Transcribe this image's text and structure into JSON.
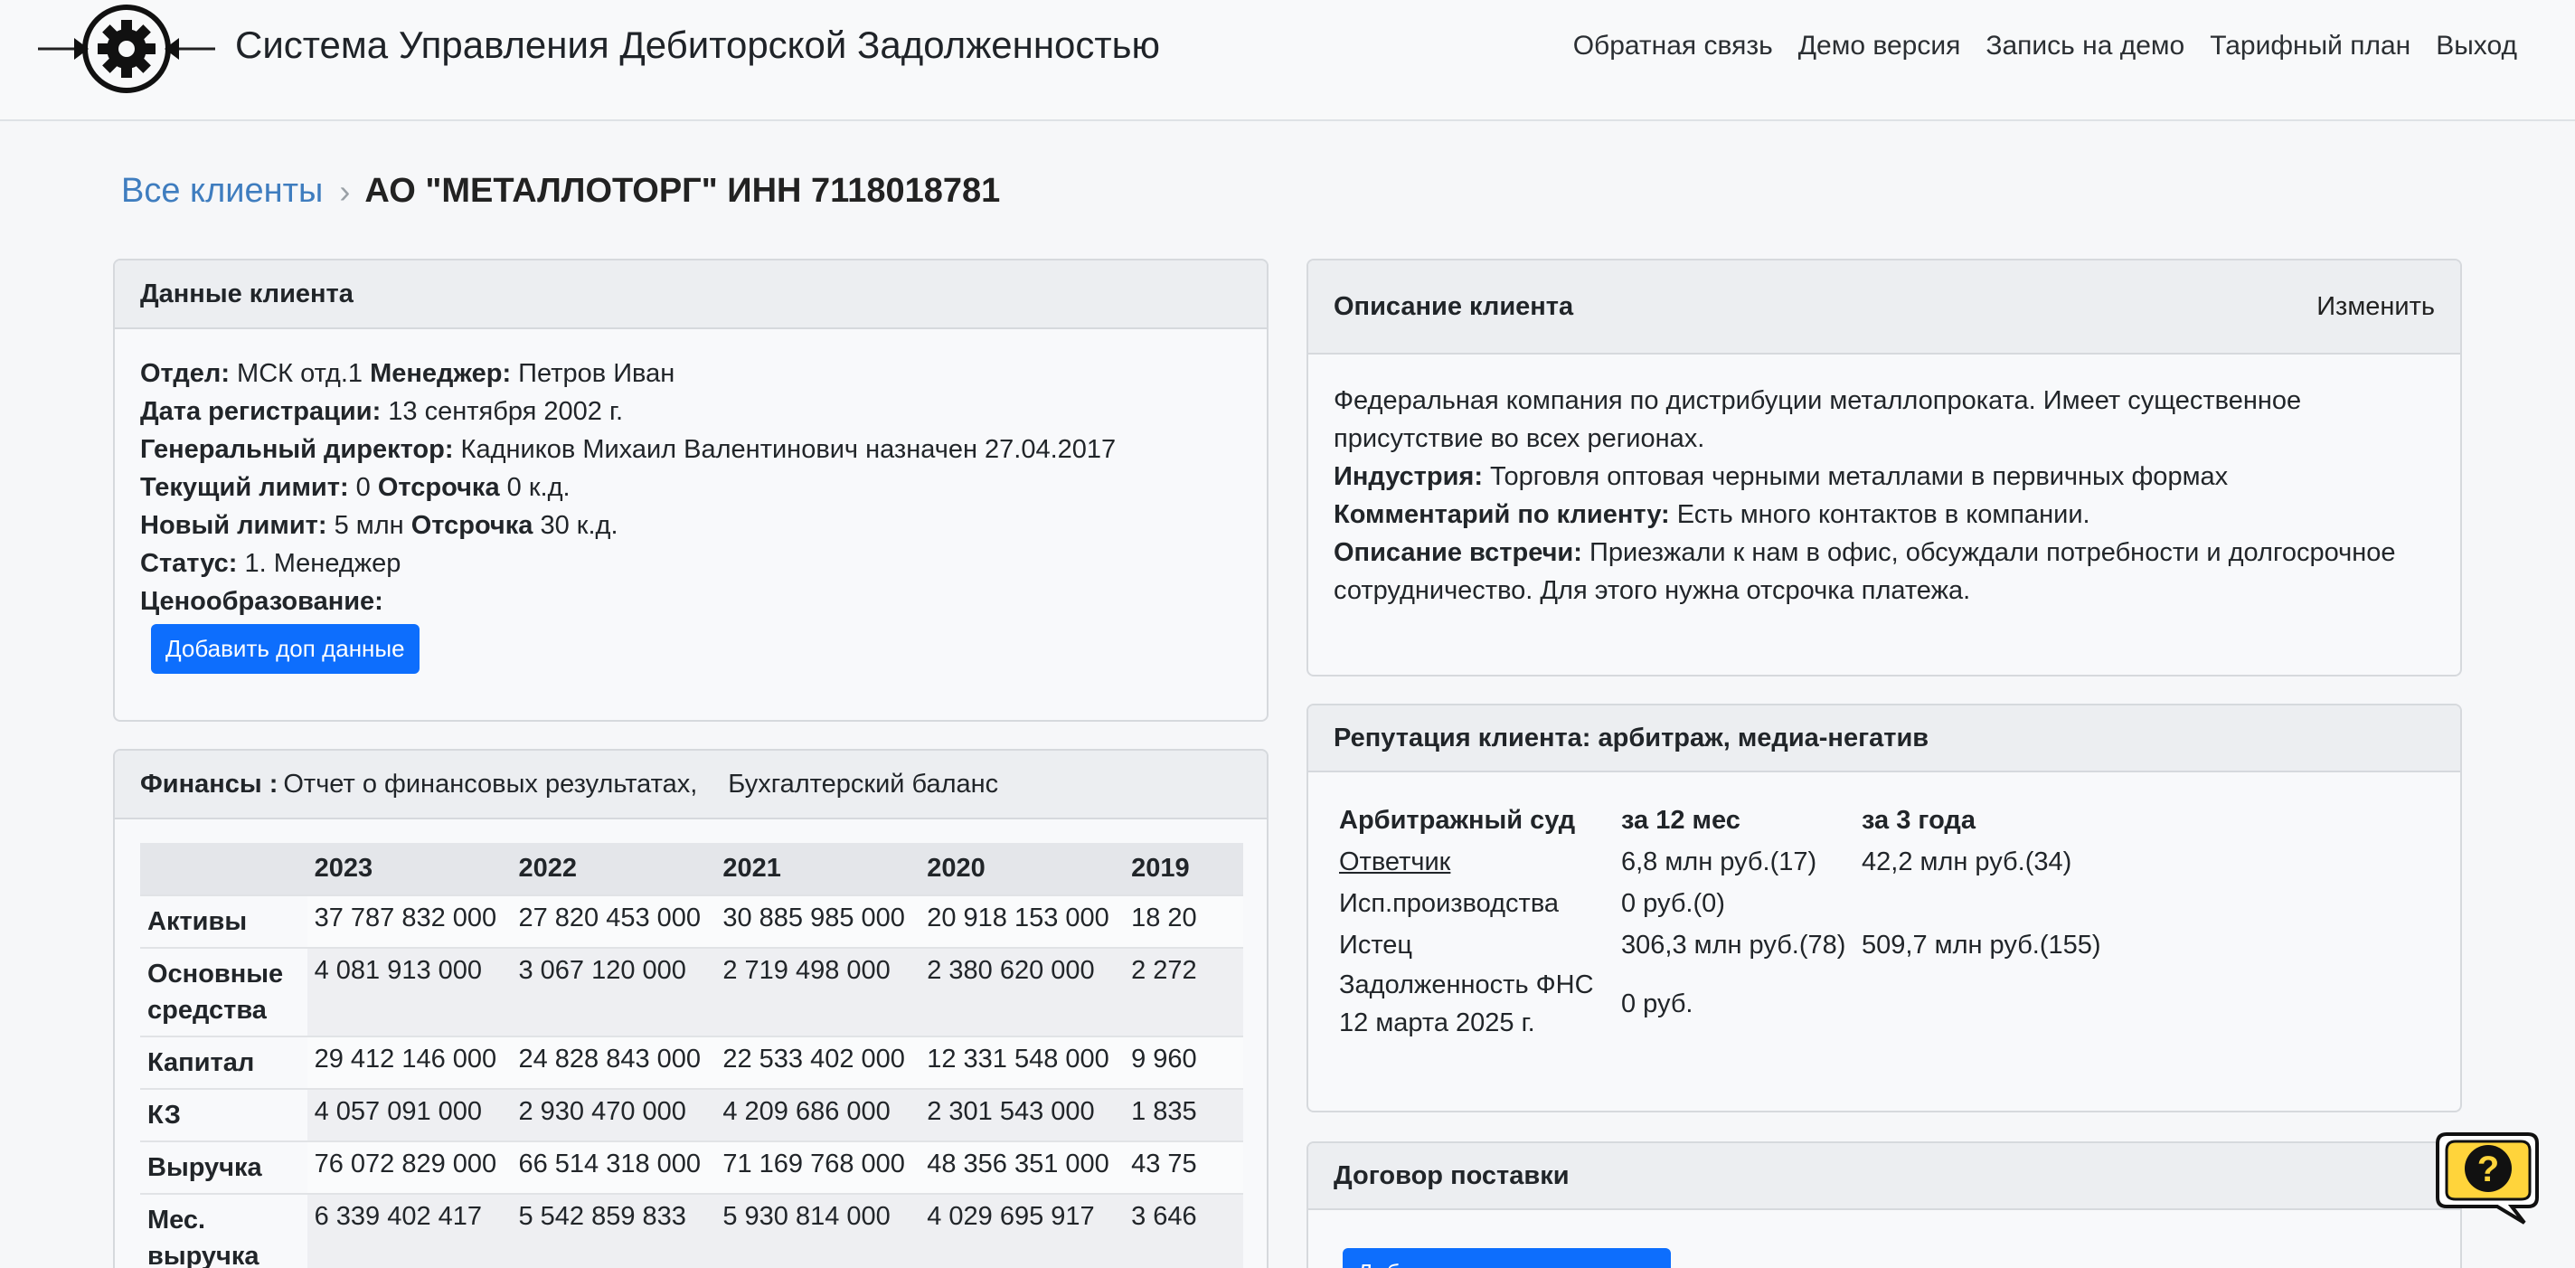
{
  "header": {
    "title": "Система Управления Дебиторской Задолженностью",
    "nav": [
      "Обратная связь",
      "Демо версия",
      "Запись на демо",
      "Тарифный план",
      "Выход"
    ]
  },
  "breadcrumb": {
    "root": "Все клиенты",
    "current": "АО \"МЕТАЛЛОТОРГ\" ИНН 7118018781"
  },
  "client_card": {
    "title": "Данные клиента",
    "rows": {
      "dept_label": "Отдел:",
      "dept_value": " МСК отд.1 ",
      "manager_label": "Менеджер:",
      "manager_value": " Петров Иван",
      "reg_label": "Дата регистрации:",
      "reg_value": " 13 сентября 2002 г.",
      "ceo_label": "Генеральный директор:",
      "ceo_value": " Кадников Михаил Валентинович назначен 27.04.2017",
      "cur_limit_label": "Текущий лимит:",
      "cur_limit_value": " 0 ",
      "cur_delay_label": "Отсрочка",
      "cur_delay_value": " 0 к.д.",
      "new_limit_label": "Новый лимит:",
      "new_limit_value": " 5 млн ",
      "new_delay_label": "Отсрочка",
      "new_delay_value": " 30 к.д.",
      "status_label": "Статус:",
      "status_value": " 1. Менеджер",
      "pricing_label": "Ценообразование:"
    },
    "add_button": "Добавить доп данные"
  },
  "finance_card": {
    "title": "Финансы :",
    "link1": "Отчет о финансовых результатах,",
    "link2": "Бухгалтерский баланс",
    "years": [
      "2023",
      "2022",
      "2021",
      "2020",
      "2019"
    ],
    "rows": [
      {
        "label": "Активы",
        "values": [
          "37 787 832 000",
          "27 820 453 000",
          "30 885 985 000",
          "20 918 153 000",
          "18 20"
        ]
      },
      {
        "label": "Основные средства",
        "values": [
          "4 081 913 000",
          "3 067 120 000",
          "2 719 498 000",
          "2 380 620 000",
          "2 272"
        ]
      },
      {
        "label": "Капитал",
        "values": [
          "29 412 146 000",
          "24 828 843 000",
          "22 533 402 000",
          "12 331 548 000",
          "9 960"
        ]
      },
      {
        "label": "КЗ",
        "values": [
          "4 057 091 000",
          "2 930 470 000",
          "4 209 686 000",
          "2 301 543 000",
          "1 835"
        ]
      },
      {
        "label": "Выручка",
        "values": [
          "76 072 829 000",
          "66 514 318 000",
          "71 169 768 000",
          "48 356 351 000",
          "43 75"
        ]
      },
      {
        "label": "Мес. выручка",
        "values": [
          "6 339 402 417",
          "5 542 859 833",
          "5 930 814 000",
          "4 029 695 917",
          "3 646"
        ]
      }
    ]
  },
  "desc_card": {
    "title": "Описание клиента",
    "edit_button": "Изменить",
    "summary": "Федеральная компания по дистрибуции металлопроката. Имеет существенное присутствие во всех регионах.",
    "industry_label": "Индустрия:",
    "industry_value": " Торговля оптовая черными металлами в первичных формах",
    "comment_label": "Комментарий по клиенту:",
    "comment_value": " Есть много контактов в компании.",
    "meeting_label": "Описание встречи:",
    "meeting_value": " Приезжали к нам в офис, обсуждали потребности и долгосрочное сотрудничество. Для этого нужна отсрочка платежа."
  },
  "reputation_card": {
    "title": "Репутация клиента: арбитраж, медиа-негатив",
    "head": [
      "Арбитражный суд",
      "за 12 мес",
      "за 3 года"
    ],
    "rows": [
      {
        "label": "Ответчик",
        "m12": "6,8 млн руб.(17)",
        "y3": "42,2 млн руб.(34)"
      },
      {
        "label": "Исп.производства",
        "m12": "0 руб.(0)",
        "y3": ""
      },
      {
        "label": "Истец",
        "m12": "306,3 млн руб.(78)",
        "y3": "509,7 млн руб.(155)"
      },
      {
        "label": "Задолженность ФНС 12 марта 2025 г.",
        "m12": "0 руб.",
        "y3": ""
      }
    ]
  },
  "contract_card": {
    "title": "Договор поставки",
    "button": "Добавить данные договора"
  },
  "colors": {
    "primary": "#0d6efd",
    "link": "#3f7dbf",
    "help_bubble": "#ffd43b"
  },
  "icons": [
    "gear-logo-icon",
    "chevron-right-icon",
    "help-question-icon"
  ]
}
